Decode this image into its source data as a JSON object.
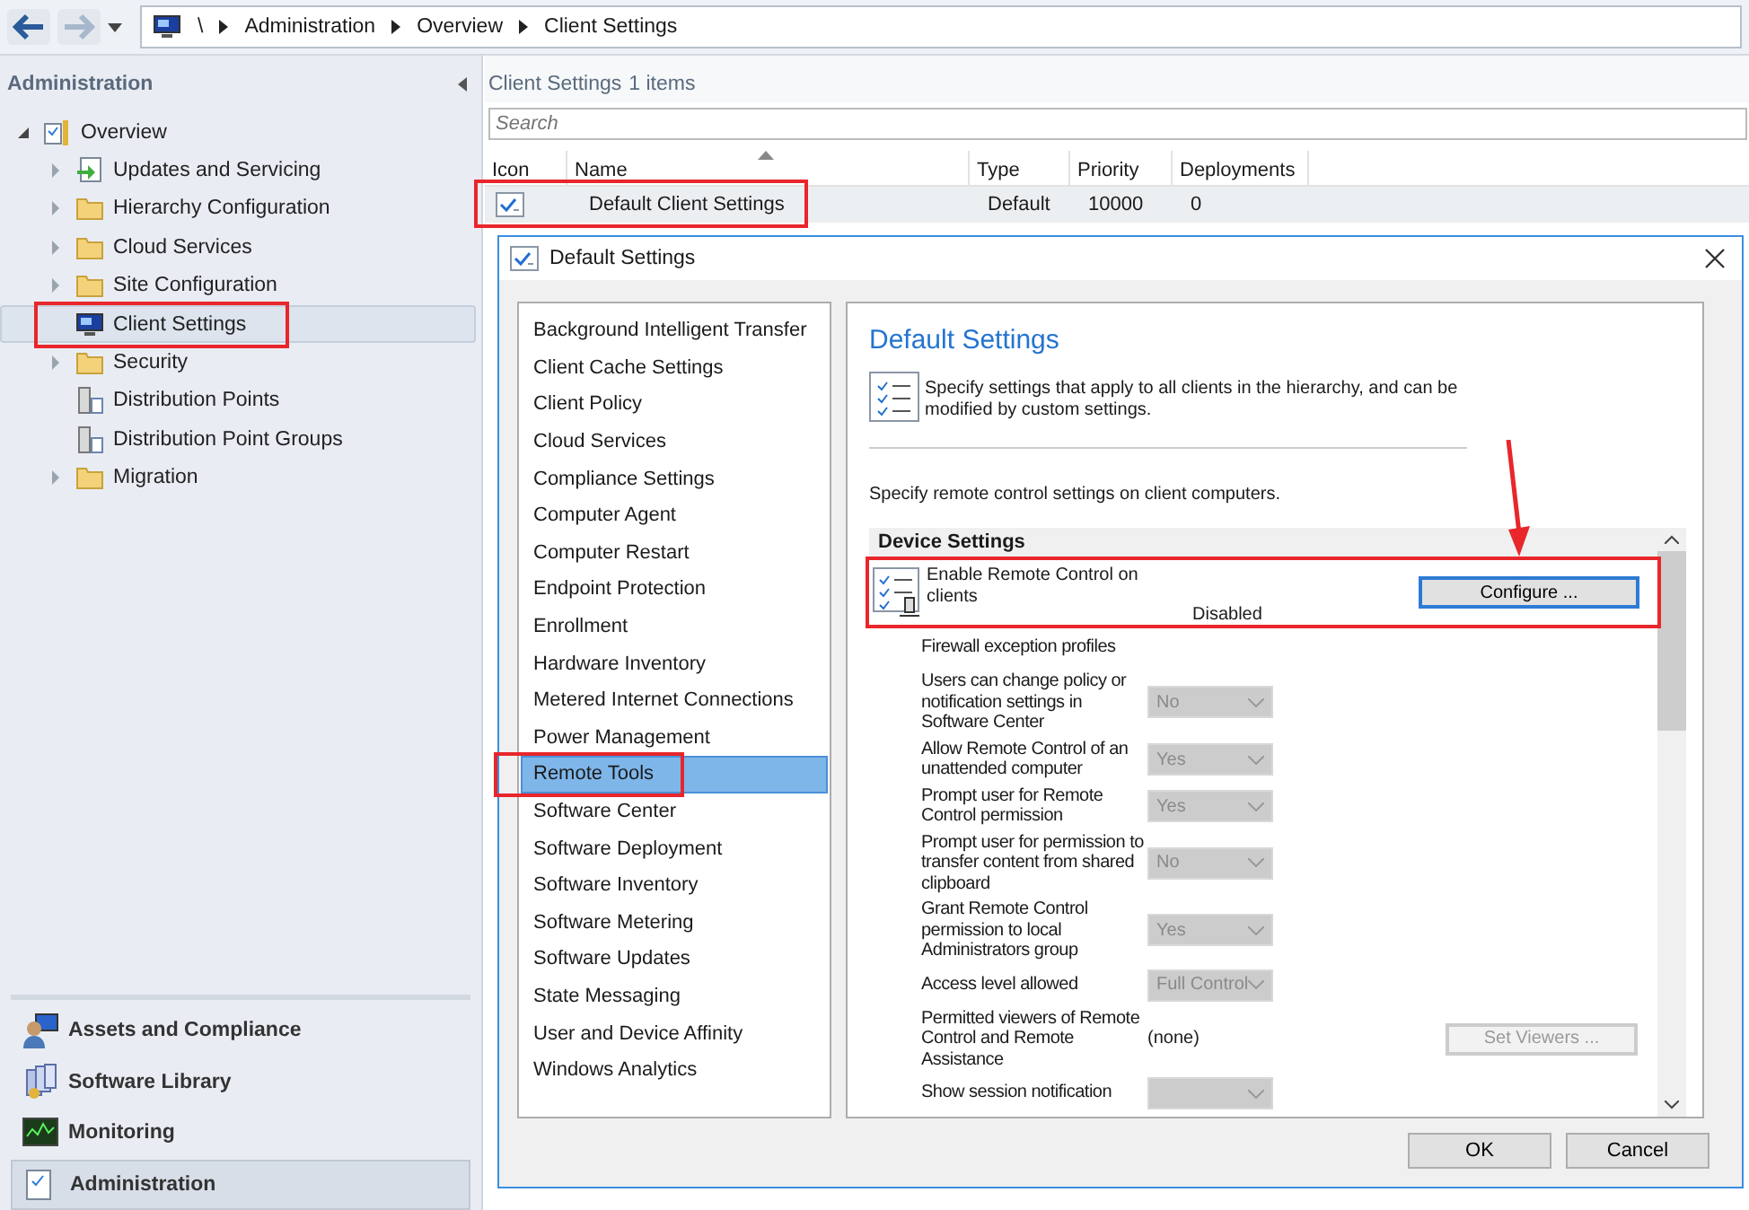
{
  "toolbar": {
    "breadcrumb": [
      "\\",
      "Administration",
      "Overview",
      "Client Settings"
    ]
  },
  "sidebar": {
    "title": "Administration",
    "tree": [
      {
        "label": "Overview",
        "kind": "overview",
        "expanded": true,
        "selected": false,
        "annotated": false,
        "children": [
          {
            "label": "Updates and Servicing",
            "kind": "update",
            "expanded": false,
            "selected": false,
            "annotated": false
          },
          {
            "label": "Hierarchy Configuration",
            "kind": "folder",
            "expanded": false,
            "selected": false,
            "annotated": false
          },
          {
            "label": "Cloud Services",
            "kind": "folder",
            "expanded": false,
            "selected": false,
            "annotated": false
          },
          {
            "label": "Site Configuration",
            "kind": "folder",
            "expanded": false,
            "selected": false,
            "annotated": false
          },
          {
            "label": "Client Settings",
            "kind": "computer",
            "selected": true,
            "annotated": true
          },
          {
            "label": "Security",
            "kind": "folder",
            "expanded": false,
            "selected": false,
            "annotated": false
          },
          {
            "label": "Distribution Points",
            "kind": "server",
            "selected": false,
            "annotated": false
          },
          {
            "label": "Distribution Point Groups",
            "kind": "server",
            "selected": false,
            "annotated": false
          },
          {
            "label": "Migration",
            "kind": "folder",
            "expanded": false,
            "selected": false,
            "annotated": false
          }
        ]
      }
    ],
    "workspaces": [
      {
        "label": "Assets and Compliance",
        "kind": "assets",
        "selected": false
      },
      {
        "label": "Software Library",
        "kind": "library",
        "selected": false
      },
      {
        "label": "Monitoring",
        "kind": "monitor",
        "selected": false
      },
      {
        "label": "Administration",
        "kind": "admin",
        "selected": true
      }
    ]
  },
  "content": {
    "title": "Client Settings",
    "count": "1 items",
    "search": {
      "placeholder": "Search"
    },
    "table": {
      "columns": [
        {
          "label": "Icon",
          "sorted": false
        },
        {
          "label": "Name",
          "sorted": true
        },
        {
          "label": "Type",
          "sorted": false
        },
        {
          "label": "Priority",
          "sorted": false
        },
        {
          "label": "Deployments",
          "sorted": false
        }
      ],
      "rows": [
        {
          "name": "Default Client Settings",
          "type": "Default",
          "priority": "10000",
          "deployments": "0",
          "selected": true,
          "annotated": true
        }
      ]
    }
  },
  "dialog": {
    "title": "Default Settings",
    "nav": [
      {
        "label": "Background Intelligent Transfer",
        "selected": false,
        "annotated": false
      },
      {
        "label": "Client Cache Settings",
        "selected": false,
        "annotated": false
      },
      {
        "label": "Client Policy",
        "selected": false,
        "annotated": false
      },
      {
        "label": "Cloud Services",
        "selected": false,
        "annotated": false
      },
      {
        "label": "Compliance Settings",
        "selected": false,
        "annotated": false
      },
      {
        "label": "Computer Agent",
        "selected": false,
        "annotated": false
      },
      {
        "label": "Computer Restart",
        "selected": false,
        "annotated": false
      },
      {
        "label": "Endpoint Protection",
        "selected": false,
        "annotated": false
      },
      {
        "label": "Enrollment",
        "selected": false,
        "annotated": false
      },
      {
        "label": "Hardware Inventory",
        "selected": false,
        "annotated": false
      },
      {
        "label": "Metered Internet Connections",
        "selected": false,
        "annotated": false
      },
      {
        "label": "Power Management",
        "selected": false,
        "annotated": false
      },
      {
        "label": "Remote Tools",
        "selected": true,
        "annotated": true
      },
      {
        "label": "Software Center",
        "selected": false,
        "annotated": false
      },
      {
        "label": "Software Deployment",
        "selected": false,
        "annotated": false
      },
      {
        "label": "Software Inventory",
        "selected": false,
        "annotated": false
      },
      {
        "label": "Software Metering",
        "selected": false,
        "annotated": false
      },
      {
        "label": "Software Updates",
        "selected": false,
        "annotated": false
      },
      {
        "label": "State Messaging",
        "selected": false,
        "annotated": false
      },
      {
        "label": "User and Device Affinity",
        "selected": false,
        "annotated": false
      },
      {
        "label": "Windows Analytics",
        "selected": false,
        "annotated": false
      }
    ],
    "heading": "Default Settings",
    "description": "Specify settings that apply to all clients in the hierarchy, and can be modified by custom settings.",
    "section_text": "Specify remote control settings on client computers.",
    "group": "Device Settings",
    "settings": [
      {
        "kind": "configure",
        "label": "Enable Remote Control on clients",
        "value": "Disabled",
        "button": "Configure ...",
        "annotated": true,
        "arrow": true
      },
      {
        "kind": "heading",
        "label": "Firewall exception profiles"
      },
      {
        "kind": "dropdown",
        "label": "Users can change policy or notification settings in Software Center",
        "value": "No",
        "disabled": true
      },
      {
        "kind": "dropdown",
        "label": "Allow Remote Control of an unattended computer",
        "value": "Yes",
        "disabled": true
      },
      {
        "kind": "dropdown",
        "label": "Prompt user for Remote Control permission",
        "value": "Yes",
        "disabled": true
      },
      {
        "kind": "dropdown",
        "label": "Prompt user for permission to transfer content from shared clipboard",
        "value": "No",
        "disabled": true
      },
      {
        "kind": "dropdown",
        "label": "Grant Remote Control permission to local Administrators group",
        "value": "Yes",
        "disabled": true
      },
      {
        "kind": "dropdown",
        "label": "Access level allowed",
        "value": "Full Control",
        "disabled": true
      },
      {
        "kind": "viewers",
        "label": "Permitted viewers of Remote Control and Remote Assistance",
        "value": "(none)",
        "button": "Set Viewers ...",
        "disabled": true
      },
      {
        "kind": "dropdown",
        "label": "Show session notification",
        "disabled": true
      }
    ],
    "buttons": [
      "OK",
      "Cancel"
    ]
  }
}
